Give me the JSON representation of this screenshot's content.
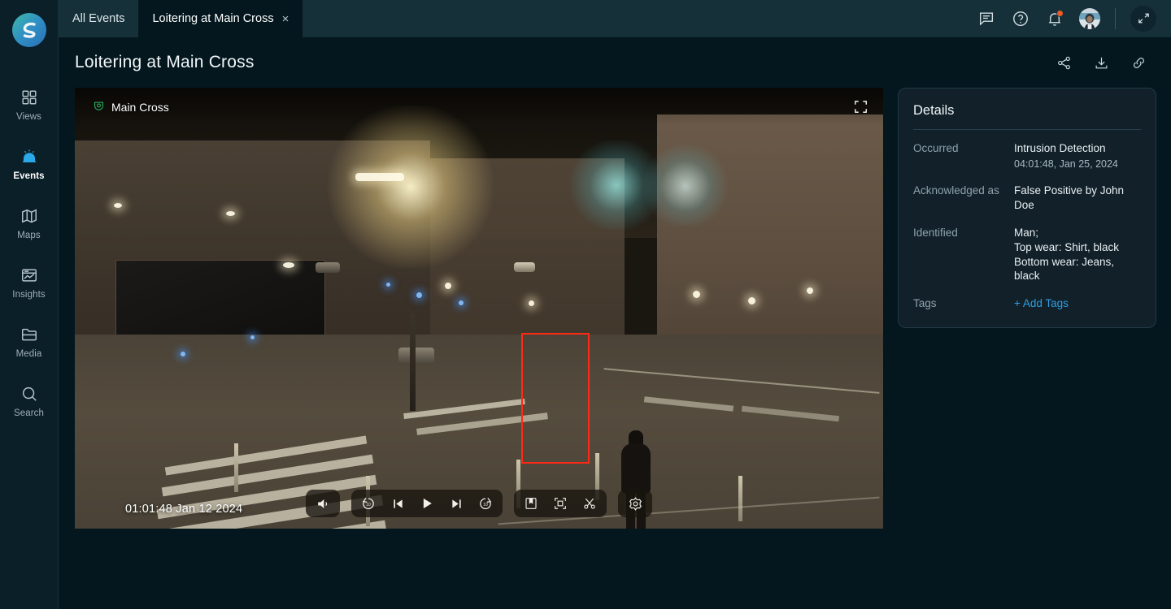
{
  "app": {
    "logo_name": "app-logo",
    "accent": "#29a9e8",
    "background": "#04171e",
    "panel_bg": "#112029"
  },
  "sidebar": {
    "items": [
      {
        "label": "Views",
        "icon": "grid-icon",
        "active": false
      },
      {
        "label": "Events",
        "icon": "alarm-icon",
        "active": true
      },
      {
        "label": "Maps",
        "icon": "map-icon",
        "active": false
      },
      {
        "label": "Insights",
        "icon": "insights-icon",
        "active": false
      },
      {
        "label": "Media",
        "icon": "folder-icon",
        "active": false
      },
      {
        "label": "Search",
        "icon": "search-icon",
        "active": false
      }
    ]
  },
  "tabbar": {
    "tabs": [
      {
        "label": "All Events",
        "active": false,
        "closable": false
      },
      {
        "label": "Loitering at Main Cross",
        "active": true,
        "closable": true,
        "close_glyph": "×"
      }
    ],
    "icons": [
      {
        "name": "chat-icon",
        "label": "Messages"
      },
      {
        "name": "help-icon",
        "label": "Help"
      },
      {
        "name": "bell-icon",
        "label": "Notifications",
        "has_badge": true
      },
      {
        "name": "avatar",
        "label": "User profile"
      }
    ],
    "expand_label": "Expand",
    "badge_color": "#f05a28"
  },
  "page": {
    "title": "Loitering at Main Cross",
    "actions": [
      {
        "name": "share-icon",
        "label": "Share"
      },
      {
        "name": "download-icon",
        "label": "Download"
      },
      {
        "name": "link-icon",
        "label": "Copy link"
      }
    ]
  },
  "video": {
    "camera_name": "Main Cross",
    "camera_icon": "camera-shield-icon",
    "fullscreen_icon": "fullscreen-icon",
    "timestamp": "01:01:48  Jan 12 2024",
    "detection_box_color": "#ff2a16",
    "controls": {
      "volume": {
        "name": "volume-icon",
        "label": "Volume"
      },
      "transport": [
        {
          "name": "rewind-10-icon",
          "label": "Rewind 10 seconds",
          "num": "10"
        },
        {
          "name": "prev-frame-icon",
          "label": "Previous frame"
        },
        {
          "name": "play-icon",
          "label": "Play"
        },
        {
          "name": "next-frame-icon",
          "label": "Next frame"
        },
        {
          "name": "forward-10-icon",
          "label": "Forward 10 seconds",
          "num": "10"
        }
      ],
      "tools": [
        {
          "name": "bookmark-icon",
          "label": "Bookmark"
        },
        {
          "name": "snapshot-icon",
          "label": "Snapshot"
        },
        {
          "name": "clip-icon",
          "label": "Create clip"
        }
      ],
      "settings": {
        "name": "gear-icon",
        "label": "Settings"
      }
    }
  },
  "details": {
    "title": "Details",
    "rows": [
      {
        "key": "Occurred",
        "value": "Intrusion Detection",
        "sub": "04:01:48, Jan 25, 2024",
        "type": "text"
      },
      {
        "key": "Acknowledged as",
        "value": "False Positive by John Doe",
        "type": "text"
      },
      {
        "key": "Identified",
        "value": "Man;\nTop wear: Shirt, black\nBottom wear: Jeans, black",
        "type": "text"
      },
      {
        "key": "Tags",
        "value": "+ Add Tags",
        "type": "link"
      }
    ]
  }
}
